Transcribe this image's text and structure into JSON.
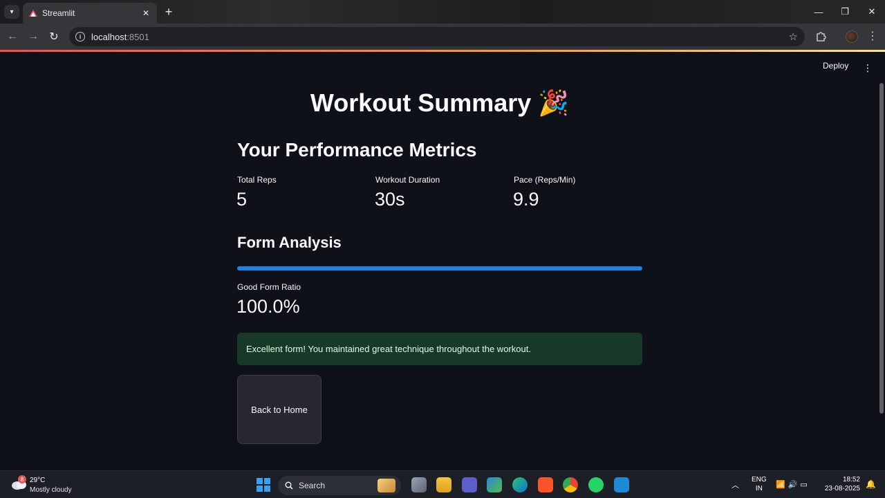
{
  "browser": {
    "tab_title": "Streamlit",
    "url_host": "localhost",
    "url_port": ":8501"
  },
  "app": {
    "deploy_label": "Deploy",
    "title": "Workout Summary 🎉",
    "metrics_heading": "Your Performance Metrics",
    "metrics": [
      {
        "label": "Total Reps",
        "value": "5"
      },
      {
        "label": "Workout Duration",
        "value": "30s"
      },
      {
        "label": "Pace (Reps/Min)",
        "value": "9.9"
      }
    ],
    "form_heading": "Form Analysis",
    "form_progress_percent": 100,
    "good_form": {
      "label": "Good Form Ratio",
      "value": "100.0%"
    },
    "success_message": "Excellent form! You maintained great technique throughout the workout.",
    "back_button_label": "Back to Home",
    "colors": {
      "background": "#0e1117",
      "progress": "#1c83e1",
      "success_bg": "#173928"
    }
  },
  "taskbar": {
    "weather_badge": "8",
    "weather_temp": "29°C",
    "weather_desc": "Mostly cloudy",
    "search_label": "Search",
    "lang_line1": "ENG",
    "lang_line2": "IN",
    "time": "18:52",
    "date": "23-08-2025"
  }
}
